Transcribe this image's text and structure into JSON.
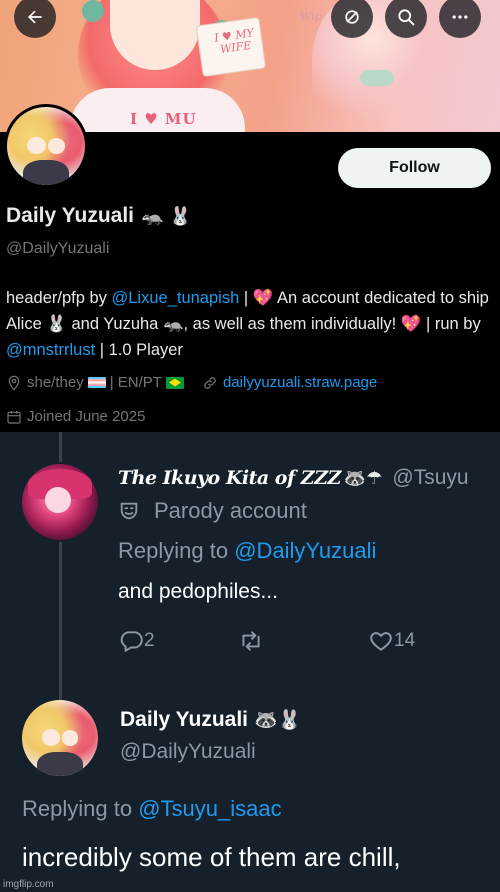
{
  "profile": {
    "banner": {
      "sign_text": "I ♥ MY WIFE",
      "shirt_text": "I ♥ MU",
      "watermark": "Wip"
    },
    "follow_label": "Follow",
    "display_name": "Daily Yuzuali",
    "display_name_emoji": "🦡 🐰",
    "handle": "@DailyYuzuali",
    "bio": {
      "part1": "header/pfp by ",
      "mention1": "@Lixue_tunapish",
      "part2": " | ",
      "heart1": "💖",
      "part3": " An account dedicated to ship Alice ",
      "bunny": "🐰",
      "part4": " and Yuzuha ",
      "badger": "🦡",
      "part5": ", as well as them individually! ",
      "heart2": "💖",
      "part6": " | run by ",
      "mention2": "@mnstrrlust",
      "part7": " | 1.0 Player"
    },
    "pronouns": "she/they",
    "lang": "| EN/PT",
    "website": "dailyyuzuali.straw.page",
    "joined": "Joined June 2025"
  },
  "reply": {
    "author_name": "The Ikuyo Kita of ZZZ",
    "author_emoji": "🦝☂",
    "handle": "@Tsuyu",
    "parody_label": "Parody account",
    "replying_prefix": "Replying to ",
    "replying_to": "@DailyYuzuali",
    "text": "and pedophiles...",
    "reply_count": "2",
    "retweet_count": "",
    "like_count": "14"
  },
  "op_reply": {
    "author_name": "Daily Yuzuali",
    "author_emoji": "🦝🐰",
    "handle": "@DailyYuzuali",
    "replying_prefix": "Replying to ",
    "replying_to": "@Tsuyu_isaac",
    "text_line1": "incredibly some of them are chill,"
  },
  "footer": {
    "watermark": "imgflip.com"
  },
  "colors": {
    "accent": "#1d9bf0",
    "thread_bg": "#15202b",
    "profile_bg": "#000000"
  }
}
